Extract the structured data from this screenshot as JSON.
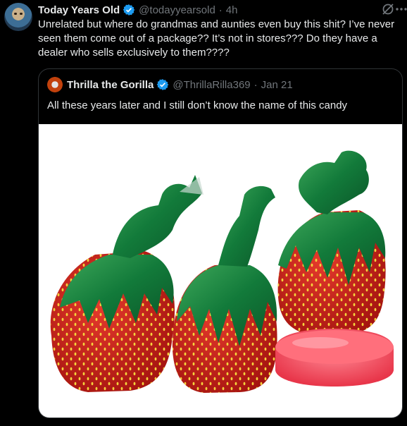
{
  "tweet": {
    "author_name": "Today Years Old",
    "handle": "@todayyearsold",
    "separator": "·",
    "time": "4h",
    "text": "Unrelated but where do grandmas and aunties even buy this shit? I’ve never seen them come out of a package?? It’s not in stores??? Do they have a dealer who sells exclusively to them????"
  },
  "quoted": {
    "author_name": "Thrilla the Gorilla",
    "handle": "@ThrillaRilla369",
    "separator": "·",
    "date": "Jan 21",
    "text": "All these years later and I still don’t know the name of this candy"
  },
  "icons": {
    "verified": "verified-badge-icon",
    "grok": "grok-icon",
    "more": "more-icon"
  },
  "colors": {
    "background": "#000000",
    "text": "#e7e9ea",
    "secondary": "#71767b",
    "verified": "#1d9bf0",
    "border": "#2f3336"
  }
}
